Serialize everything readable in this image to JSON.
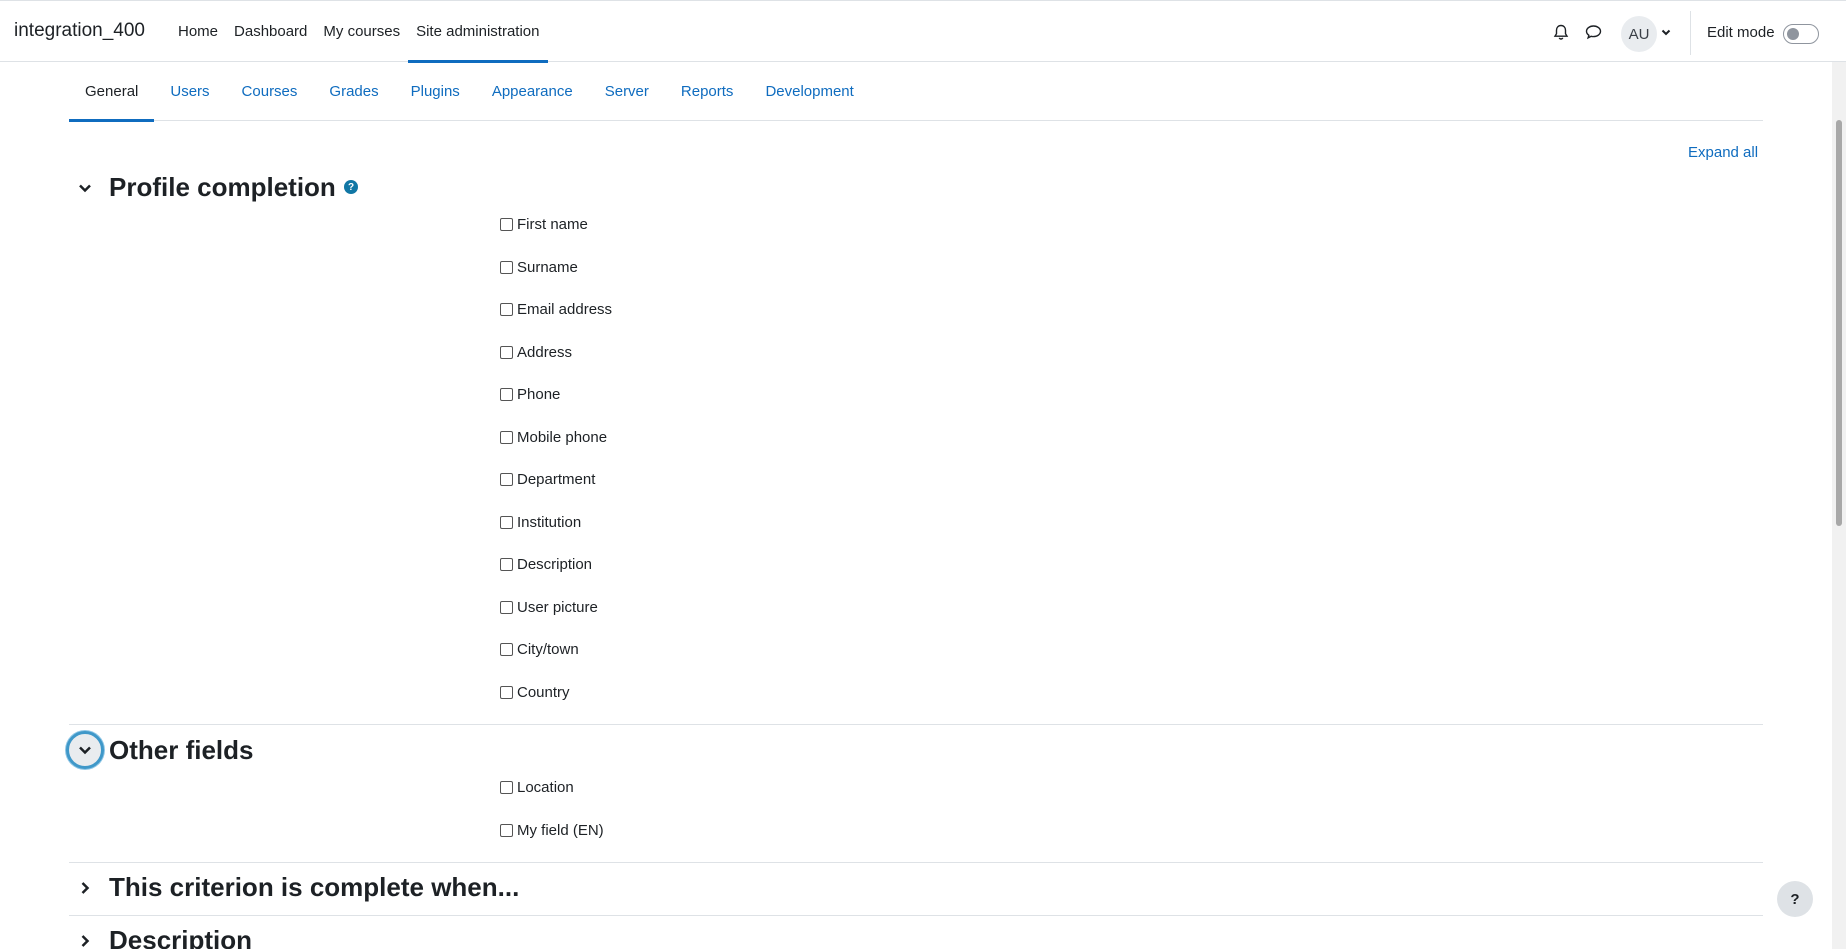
{
  "site_name": "integration_400",
  "primary_nav": [
    "Home",
    "Dashboard",
    "My courses",
    "Site administration"
  ],
  "user": {
    "initials": "AU"
  },
  "edit_mode_label": "Edit mode",
  "secondary_nav": [
    "General",
    "Users",
    "Courses",
    "Grades",
    "Plugins",
    "Appearance",
    "Server",
    "Reports",
    "Development"
  ],
  "expand_all": "Expand all",
  "sections": {
    "profile_completion": {
      "title": "Profile completion",
      "fields": [
        "First name",
        "Surname",
        "Email address",
        "Address",
        "Phone",
        "Mobile phone",
        "Department",
        "Institution",
        "Description",
        "User picture",
        "City/town",
        "Country"
      ]
    },
    "other_fields": {
      "title": "Other fields",
      "fields": [
        "Location",
        "My field (EN)"
      ]
    },
    "criterion": {
      "title": "This criterion is complete when..."
    },
    "description": {
      "title": "Description"
    }
  },
  "help_button": "?",
  "colors": {
    "link": "#0f6cbf",
    "text": "#1d2125",
    "border": "#dee2e6",
    "focus_ring": "#3f98c9"
  }
}
